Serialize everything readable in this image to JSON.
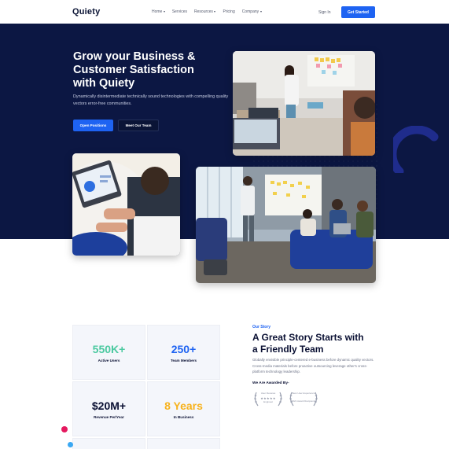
{
  "nav": {
    "logo": "Quiety",
    "links": [
      {
        "label": "Home",
        "dropdown": true
      },
      {
        "label": "Services",
        "dropdown": false
      },
      {
        "label": "Resources",
        "dropdown": true
      },
      {
        "label": "Pricing",
        "dropdown": false
      },
      {
        "label": "Company",
        "dropdown": true
      }
    ],
    "signin": "Sign In",
    "cta": "Get Started"
  },
  "hero": {
    "title_lines": [
      "Grow your Business &",
      "Customer Satisfaction",
      "with Quiety"
    ],
    "description": "Dynamically disintermediate technically sound technologies with compelling quality vectors error-free communities.",
    "primary_button": "Open Positions",
    "secondary_button": "Meet Our Team"
  },
  "stats": [
    {
      "value": "550K+",
      "label": "Active Users",
      "color": "#4bc9a0"
    },
    {
      "value": "250+",
      "label": "Team Members",
      "color": "#1e63f2"
    },
    {
      "value": "$20M+",
      "label": "Revenue Per/Year",
      "color": "#0a1033"
    },
    {
      "value": "8 Years",
      "label": "In Business",
      "color": "#f7b21c"
    }
  ],
  "story": {
    "tag": "Our Story",
    "title_lines": [
      "A Great Story Starts with",
      "a Friendly Team"
    ],
    "description": "Globally envisible principle-centered e-business before dynamic quality vectors. Cross-media materials before proactive outsourcing leverage other's cross-platform technology leadership.",
    "awarded_label": "We Are Awarded By-",
    "awards": [
      {
        "top": "User Reviews",
        "stars": "★★★★★",
        "bottom": "Enginest"
      },
      {
        "top": "Best User Experience",
        "stars": "",
        "bottom": "2021 Award Recipients"
      }
    ]
  },
  "colors": {
    "hero_bg": "#0c1743",
    "primary": "#1e63f2",
    "arc": "#1e2a8a"
  }
}
